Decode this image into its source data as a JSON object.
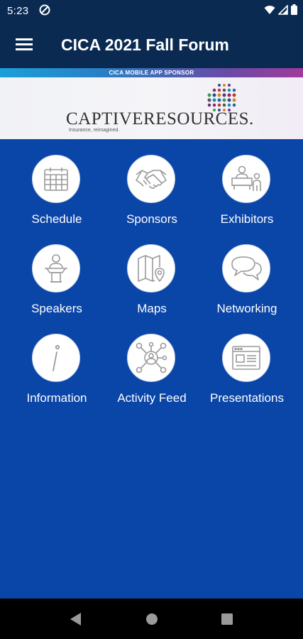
{
  "status_bar": {
    "time": "5:23"
  },
  "app_bar": {
    "title": "CICA 2021 Fall Forum"
  },
  "sponsor": {
    "strip_label": "CICA MOBILE APP SPONSOR",
    "logo_name": "CAPTIVERESOURCES.",
    "logo_tagline": "Insurance, reimagined."
  },
  "tiles": [
    {
      "label": "Schedule",
      "icon": "calendar-icon"
    },
    {
      "label": "Sponsors",
      "icon": "handshake-icon"
    },
    {
      "label": "Exhibitors",
      "icon": "exhibitor-booth-icon"
    },
    {
      "label": "Speakers",
      "icon": "speaker-podium-icon"
    },
    {
      "label": "Maps",
      "icon": "map-pin-icon"
    },
    {
      "label": "Networking",
      "icon": "chat-bubbles-icon"
    },
    {
      "label": "Information",
      "icon": "info-icon"
    },
    {
      "label": "Activity Feed",
      "icon": "network-people-icon"
    },
    {
      "label": "Presentations",
      "icon": "presentation-window-icon"
    }
  ],
  "colors": {
    "header": "#0a2a52",
    "background": "#0a45a8",
    "tile_circle": "#ffffff"
  }
}
